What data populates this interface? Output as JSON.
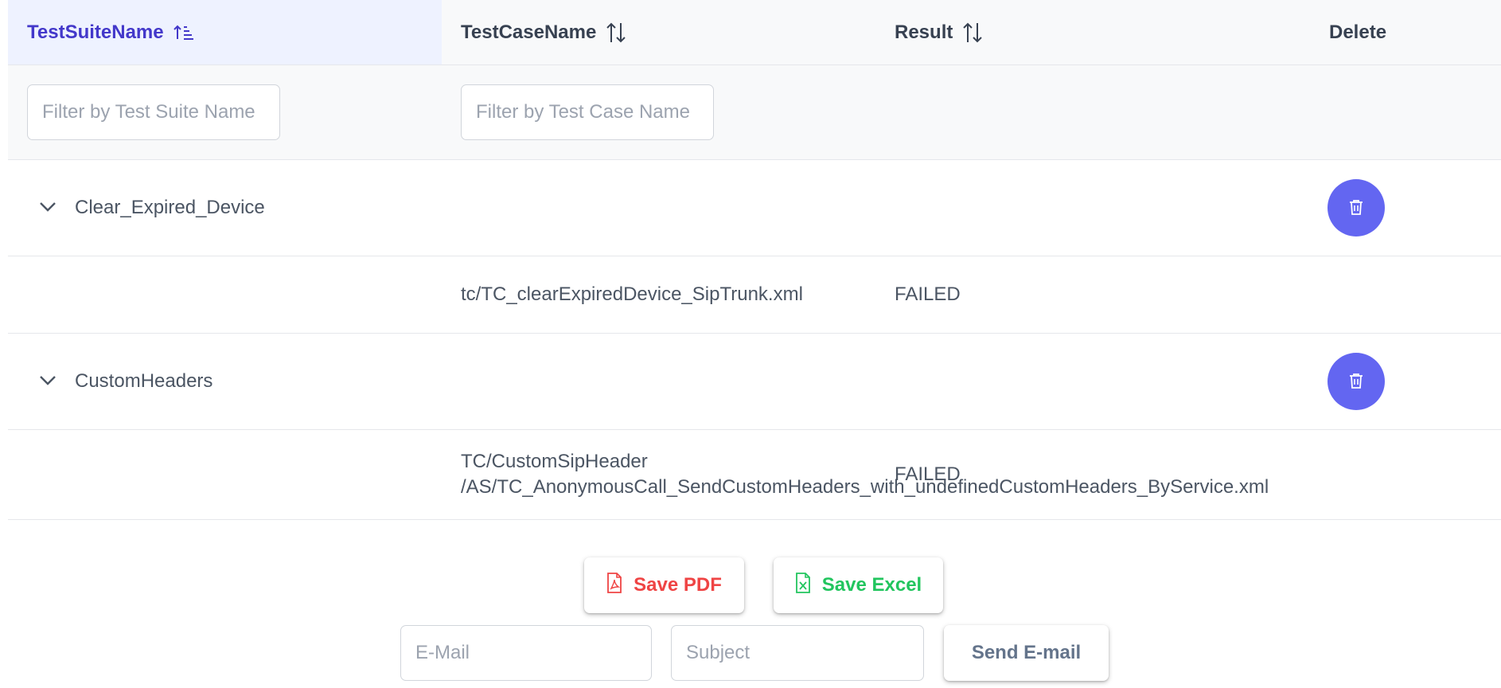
{
  "table": {
    "columns": {
      "suite": "TestSuiteName",
      "case": "TestCaseName",
      "result": "Result",
      "delete": "Delete"
    },
    "filters": {
      "suite_placeholder": "Filter by Test Suite Name",
      "case_placeholder": "Filter by Test Case Name"
    },
    "groups": [
      {
        "name": "Clear_Expired_Device",
        "cases": [
          {
            "name_line1": "tc/TC_clearExpiredDevice_SipTrunk.xml",
            "name_line2": "",
            "result": "FAILED"
          }
        ]
      },
      {
        "name": "CustomHeaders",
        "cases": [
          {
            "name_line1": "TC/CustomSipHeader",
            "name_line2": "/AS/TC_AnonymousCall_SendCustomHeaders_with_undefinedCustomHeaders_ByService.xml",
            "result": "FAILED"
          }
        ]
      }
    ]
  },
  "actions": {
    "save_pdf": "Save PDF",
    "save_excel": "Save Excel",
    "email_placeholder": "E-Mail",
    "subject_placeholder": "Subject",
    "send_email": "Send E-mail"
  },
  "colors": {
    "accent": "#6366f1",
    "sorted_header": "#4338ca",
    "pdf": "#ef4444",
    "excel": "#22c55e",
    "send": "#64748b"
  },
  "icons": {
    "sort_active": "sort-amount-up-icon",
    "sort_inactive": "sort-alt-icon",
    "expand": "chevron-down-icon",
    "delete": "trash-icon",
    "pdf": "file-pdf-icon",
    "excel": "file-excel-icon"
  }
}
